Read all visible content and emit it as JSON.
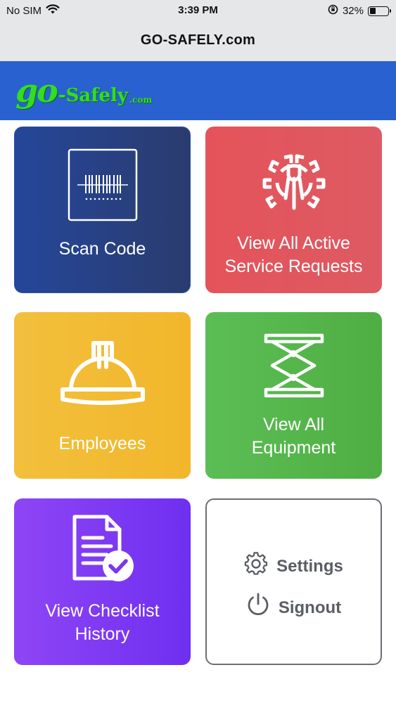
{
  "status_bar": {
    "carrier": "No SIM",
    "time": "3:39 PM",
    "battery_percent": "32%",
    "battery_level": 0.32,
    "icons": [
      "wifi-icon",
      "orientation-lock-icon",
      "battery-icon"
    ]
  },
  "browser": {
    "url": "GO-SAFELY.com"
  },
  "brand": {
    "logo_go": "go",
    "logo_safely": "-Safely",
    "logo_com": ".com",
    "bar_color": "#2962d0",
    "logo_color": "#33dd22"
  },
  "tiles": {
    "scan": {
      "label": "Scan Code",
      "icon": "barcode-scan-icon",
      "color": "#25469a"
    },
    "service": {
      "label_line1": "View All Active",
      "label_line2": "Service Requests",
      "icon": "gear-wrench-icon",
      "color": "#e4535a"
    },
    "employees": {
      "label": "Employees",
      "icon": "hard-hat-icon",
      "color": "#f2c03c"
    },
    "equipment": {
      "label_line1": "View All",
      "label_line2": "Equipment",
      "icon": "scissor-lift-icon",
      "color": "#5bbe55"
    },
    "history": {
      "label_line1": "View Checklist",
      "label_line2": "History",
      "icon": "document-check-icon",
      "color": "#8e45f5"
    },
    "menu": {
      "settings_label": "Settings",
      "signout_label": "Signout",
      "settings_icon": "gear-icon",
      "signout_icon": "power-icon"
    }
  }
}
